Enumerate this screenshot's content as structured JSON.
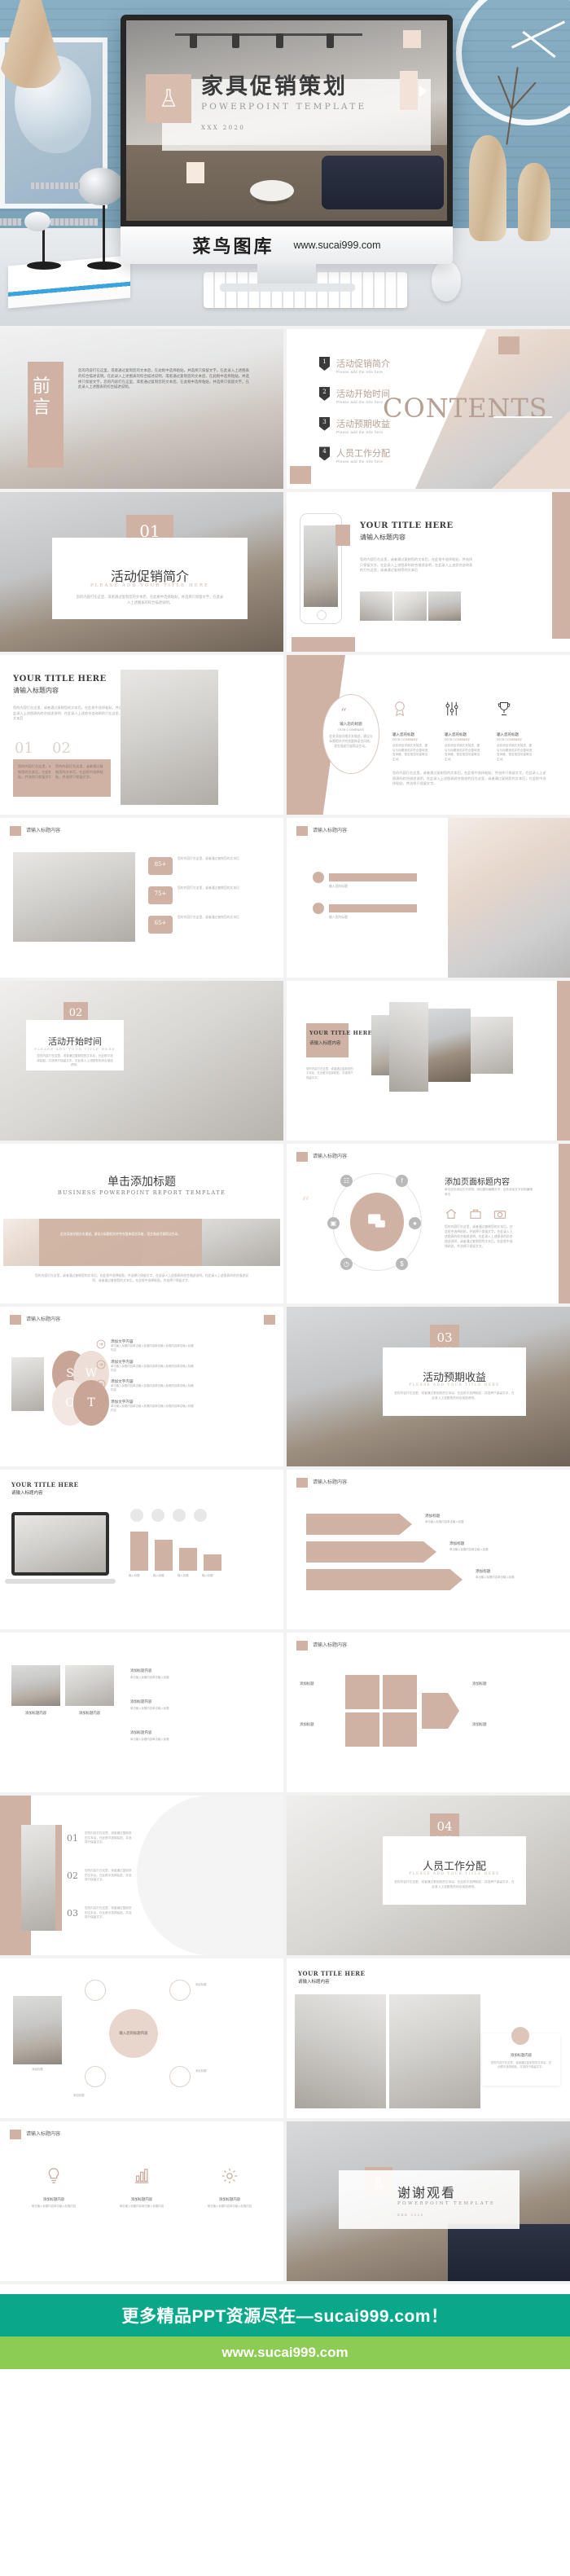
{
  "colors": {
    "accent_tan": "#cfb2a3",
    "accent_tan_light": "#f0e2d9",
    "banner_green": "#0aa88a",
    "banner_lime": "#8dcc52",
    "text_dark": "#3d3d3d",
    "text_muted": "#a9a9a9"
  },
  "hero": {
    "title_cn": "家具促销策划",
    "title_en": "POWERPOINT    TEMPLATE",
    "date_line": "XXX  2020",
    "brand_cn": "菜鸟图库",
    "brand_url": "www.sucai999.com",
    "flask_icon": "flask-icon",
    "play_icon": "play-triangle-icon"
  },
  "slides": [
    {
      "id": "preface",
      "label_cn": "前言",
      "body": "您的内容打在这里，或者通过复制您的文本后，在此框中选择粘贴，并选择只保留文字。在此录入上述图表的综合描述说明。在此录入上述图表的综合描述说明，或者通过复制您的文本后，在此框中选择粘贴，并选择只保留文字。您的内容打在这里，或者通过复制您的文本后，在此框中选择粘贴，并选择只保留文字。在此录入上述图表的综合描述说明。"
    },
    {
      "id": "contents",
      "heading_en": "CONTENTS",
      "items": [
        {
          "num": "1",
          "title": "活动促销简介",
          "sub": "Please add the title here"
        },
        {
          "num": "2",
          "title": "活动开始时间",
          "sub": "Please add the title here"
        },
        {
          "num": "3",
          "title": "活动预期收益",
          "sub": "Please add the title here"
        },
        {
          "num": "4",
          "title": "人员工作分配",
          "sub": "Please add the title here"
        }
      ]
    },
    {
      "id": "part01",
      "num": "01",
      "part_word": "PART",
      "title_cn": "活动促销简介",
      "title_en": "PLEASE ADD YOUR TITLE HERE",
      "body": "您的内容打在这里，或者通过复制您的文本后，在此框中选择粘贴，并选择只保留文字。在此录入上述图表的综合描述说明。"
    },
    {
      "id": "phone-showcase",
      "title_en": "YOUR TITLE HERE",
      "title_cn": "请输入标题内容",
      "body": "您的内容打在这里，或者通过复制您的文本后，在此框中选择粘贴，并选择只保留文字。在此录入上述图表的综合描述说明，在此录入上述综合咨询表的打在这里，或者通过复制您的文本后"
    },
    {
      "id": "two-col-text",
      "title_en": "YOUR TITLE HERE",
      "title_cn": "请输入标题内容",
      "body": "您的内容打在这里，或者通过复制您的文本后，在此框中选择粘贴，并选择只保留文字。在此录入上述图表的综合描述说明，在此录入上述综合咨询表的打在这里，或者通过复制您的文本后",
      "cards": [
        {
          "num": "01",
          "text": "您的内容打在这里，或者通过复制您的文本后，在此框中选择粘贴，并选择只保留文字。"
        },
        {
          "num": "02",
          "text": "您的内容打在这里，或者通过复制您的文本后，在此框中选择粘贴，并选择只保留文字。"
        }
      ]
    },
    {
      "id": "quote-features",
      "quote_icon": "quote-mark-icon",
      "quote_title": "输入您的标题",
      "quote_sub": "OUR COMPANY",
      "quote_body": "此处添加详细文本描述，建议与标题相关并符合整体语言风格，语言描述尽量简洁生动。",
      "features": [
        {
          "icon": "badge-icon",
          "title": "输入您的标题",
          "sub": "OUR COMPANY",
          "text": "此处添加详细文本描述，建议与标题相关并符合整体语言风格，语言描述尽量简洁生动。"
        },
        {
          "icon": "sliders-icon",
          "title": "输入您的标题",
          "sub": "OUR COMPANY",
          "text": "此处添加详细文本描述，建议与标题相关并符合整体语言风格，语言描述尽量简洁生动。"
        },
        {
          "icon": "trophy-icon",
          "title": "输入您的标题",
          "sub": "OUR COMPANY",
          "text": "此处添加详细文本描述，建议与标题相关并符合整体语言风格，语言描述尽量简洁生动。"
        }
      ],
      "footer_body": "您的内容打在这里，或者通过复制您的文本后，在此框中选择粘贴，并选择只保留文字。在此录入上述图表的综合描述说明，在此录入上述图表综合描述的打在这里，或者通过复制您的文本后，在此框中选择粘贴，并选择只保留文字。"
    },
    {
      "id": "bed-stats",
      "title_cn": "请输入标题内容",
      "stats": [
        {
          "value": "85+",
          "text": "您的内容打在这里，或者通过复制您的文本后"
        },
        {
          "value": "75+",
          "text": "您的内容打在这里，或者通过复制您的文本后"
        },
        {
          "value": "65+",
          "text": "您的内容打在这里，或者通过复制您的文本后"
        }
      ]
    },
    {
      "id": "yoga-bars",
      "title_cn": "请输入标题内容",
      "bars": [
        {
          "label": "输入您的标题",
          "sub": "OUR COMPANY"
        },
        {
          "label": "输入您的标题",
          "sub": "OUR COMPANY"
        }
      ]
    },
    {
      "id": "part02",
      "num": "02",
      "part_word": "PART",
      "title_cn": "活动开始时间",
      "title_en": "PLEASE ADD YOUR TITLE HERE",
      "body": "您的内容打在这里，或者通过复制您的文本后，在此框中选择粘贴，并选择只保留文字。在此录入上述图表的综合描述说明。"
    },
    {
      "id": "gallery-title",
      "title_en": "YOUR TITLE HERE",
      "title_cn": "请输入标题内容",
      "body": "您的内容打在这里，或者通过复制您的文本后，在此框中选择粘贴，并选择只保留文字。"
    },
    {
      "id": "click-add-title",
      "title_cn": "单击添加标题",
      "title_en": "BUSINESS  POWERPOINT  REPORT  TEMPLATE",
      "overlay_text": "此处添加详细文本描述，建议与标题相关并符合整体语言风格，语言描述尽量简洁生动。",
      "body": "您的内容打在这里，或者通过复制您的文本后，在此框中选择粘贴，并选择只保留文字。在此录入上述图表的综合描述说明。在此录入上述图表的综合描述说明，或者通过复制您的文本后，在此框中选择粘贴，并选择只保留文字。"
    },
    {
      "id": "circle-social",
      "header_cn": "请输入标题内容",
      "title_cn": "添加页面标题内容",
      "sub": "单击此处添加文字说明，添加图标编辑文字，此处添加文字说明编辑单击",
      "quote_icon": "quote-mark-icon",
      "center_icon": "chat-bubble-icon",
      "orbit_icons": [
        "book-icon",
        "facebook-icon",
        "twitter-icon",
        "dollar-icon",
        "clock-icon",
        "briefcase-icon"
      ],
      "row_icons": [
        "home-icon",
        "bag-icon",
        "camera-icon"
      ],
      "body": "您的内容打在这里，或者通过复制您的文本后，在此框中选择粘贴，并选择只保留文字。在此录入上述图表的综合描述说明，在此录入上述图表的综合描述说明，或者通过复制您的文本后，在此框中选择粘贴，并选择只保留文字。"
    },
    {
      "id": "swot",
      "header_cn": "请输入标题内容",
      "letters": [
        "S",
        "W",
        "O",
        "T"
      ],
      "rows": [
        {
          "title": "添加文字内容",
          "text": "单击输入标题内容单击输入标题内容单击输入标题内容单击输入标题内容"
        },
        {
          "title": "添加文字内容",
          "text": "单击输入标题内容单击输入标题内容单击输入标题内容单击输入标题内容"
        },
        {
          "title": "添加文字内容",
          "text": "单击输入标题内容单击输入标题内容单击输入标题内容单击输入标题内容"
        },
        {
          "title": "添加文字内容",
          "text": "单击输入标题内容单击输入标题内容单击输入标题内容单击输入标题内容"
        }
      ]
    },
    {
      "id": "part03",
      "num": "03",
      "part_word": "PART",
      "title_cn": "活动预期收益",
      "title_en": "PLEASE ADD YOUR TITLE HERE",
      "body": "您的内容打在这里，或者通过复制您的文本后，在此框中选择粘贴，并选择只保留文字。在此录入上述图表的综合描述说明。"
    },
    {
      "id": "device-bars",
      "title_en": "YOUR TITLE HERE",
      "title_cn": "请输入标题内容",
      "bars": [
        "输入标题",
        "输入标题",
        "输入标题",
        "输入标题"
      ]
    },
    {
      "id": "arrow-flow",
      "header_cn": "请输入标题内容",
      "steps": [
        {
          "title": "添加标题",
          "text": "单击输入标题内容单击输入标题"
        },
        {
          "title": "添加标题",
          "text": "单击输入标题内容单击输入标题"
        },
        {
          "title": "添加标题",
          "text": "单击输入标题内容单击输入标题"
        }
      ]
    },
    {
      "id": "gallery-three",
      "cards": [
        {
          "title": "添加标题内容",
          "text": "单击输入标题内容单击输入标题"
        },
        {
          "title": "添加标题内容",
          "text": "单击输入标题内容单击输入标题"
        },
        {
          "title": "添加标题内容",
          "text": "单击输入标题内容单击输入标题"
        }
      ]
    },
    {
      "id": "puzzle",
      "header_cn": "请输入标题内容",
      "pieces": [
        "添加标题",
        "添加标题",
        "添加标题",
        "添加标题"
      ]
    },
    {
      "id": "numbered-list",
      "items": [
        {
          "num": "01",
          "text": "您的内容打在这里，或者通过复制您的文本后，在此框中选择粘贴，并选择只保留文字。"
        },
        {
          "num": "02",
          "text": "您的内容打在这里，或者通过复制您的文本后，在此框中选择粘贴，并选择只保留文字。"
        },
        {
          "num": "03",
          "text": "您的内容打在这里，或者通过复制您的文本后，在此框中选择粘贴，并选择只保留文字。"
        }
      ]
    },
    {
      "id": "part04",
      "num": "04",
      "part_word": "PART",
      "title_cn": "人员工作分配",
      "title_en": "PLEASE ADD YOUR TITLE HERE",
      "body": "您的内容打在这里，或者通过复制您的文本后，在此框中选择粘贴，并选择只保留文字。在此录入上述图表的综合描述说明。"
    },
    {
      "id": "org-chart",
      "center": "输入您的标题内容",
      "nodes": [
        "添加标题",
        "添加标题",
        "添加标题",
        "添加标题"
      ]
    },
    {
      "id": "image-text",
      "title_en": "YOUR TITLE HERE",
      "title_cn": "请输入标题内容",
      "card_title": "添加标题内容",
      "body": "您的内容打在这里，或者通过复制您的文本后，在此框中选择粘贴，并选择只保留文字。"
    },
    {
      "id": "icon-columns",
      "header_cn": "请输入标题内容",
      "columns": [
        {
          "icon": "lightbulb-icon",
          "title": "添加标题内容",
          "text": "单击输入标题内容单击输入标题内容"
        },
        {
          "icon": "chart-icon",
          "title": "添加标题内容",
          "text": "单击输入标题内容单击输入标题内容"
        },
        {
          "icon": "gear-icon",
          "title": "添加标题内容",
          "text": "单击输入标题内容单击输入标题内容"
        }
      ]
    },
    {
      "id": "thanks",
      "title_cn": "谢谢观看",
      "title_en": "POWERPOINT    TEMPLATE",
      "date_line": "XXX  2020",
      "flask_icon": "flask-icon"
    }
  ],
  "footer": {
    "promo_text": "更多精品PPT资源尽在—sucai999.com！",
    "url_text": "www.sucai999.com"
  }
}
